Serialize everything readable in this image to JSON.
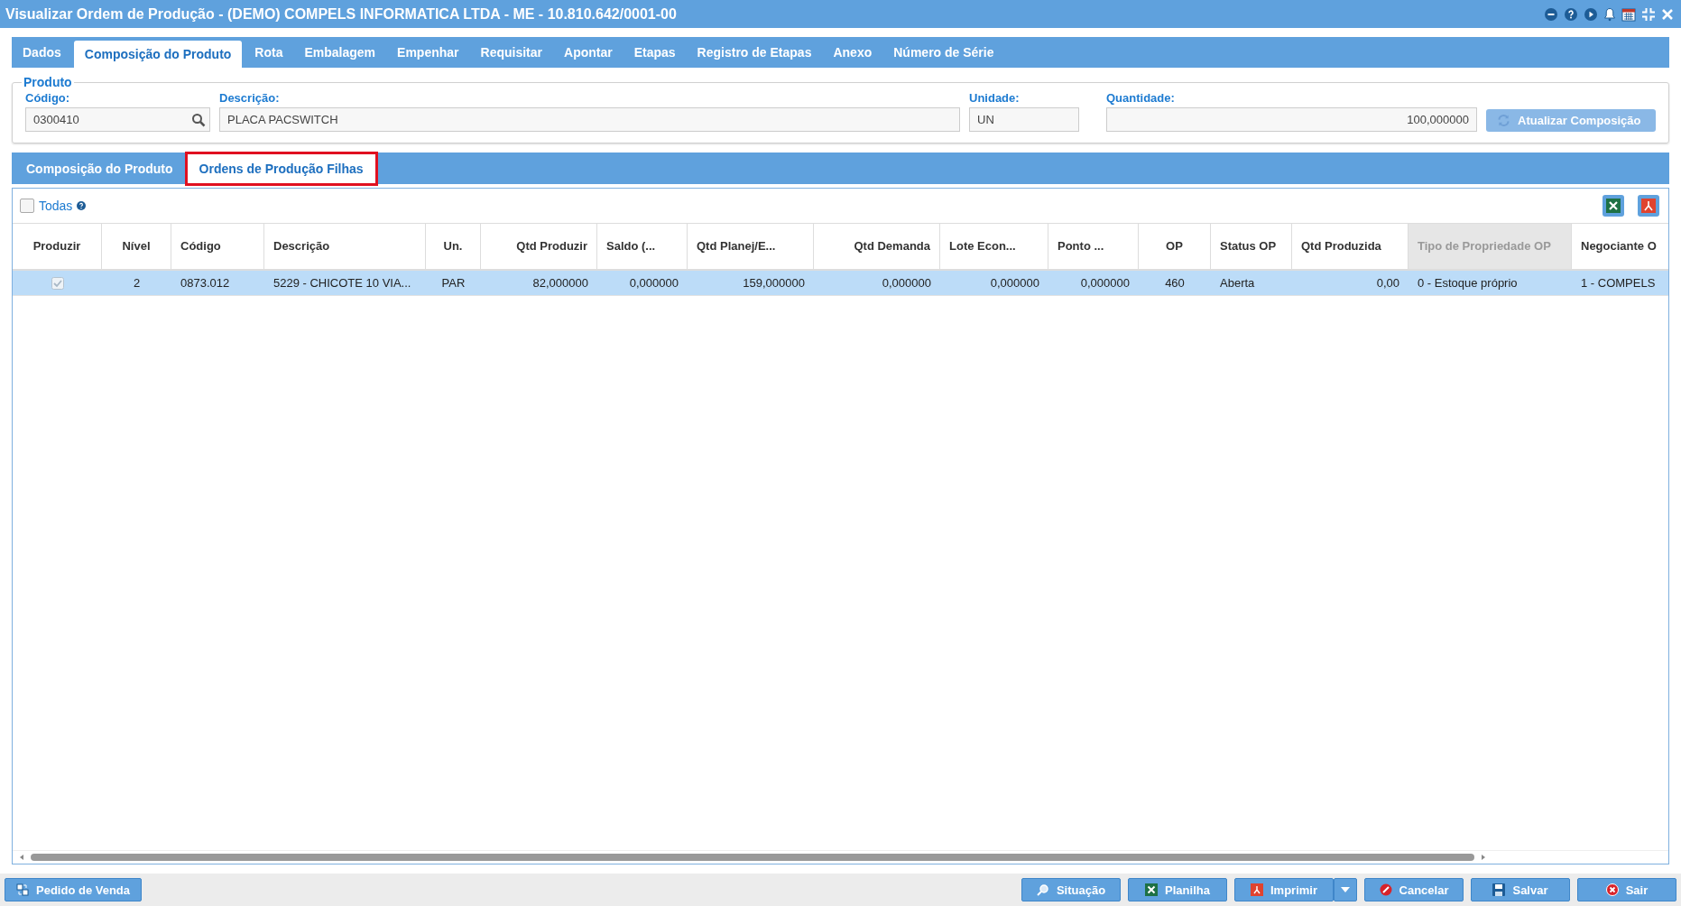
{
  "window": {
    "title": "Visualizar Ordem de Produção - (DEMO) COMPELS INFORMATICA LTDA - ME - 10.810.642/0001-00"
  },
  "tabs": [
    {
      "label": "Dados",
      "selected": false
    },
    {
      "label": "Composição do Produto",
      "selected": true
    },
    {
      "label": "Rota",
      "selected": false
    },
    {
      "label": "Embalagem",
      "selected": false
    },
    {
      "label": "Empenhar",
      "selected": false
    },
    {
      "label": "Requisitar",
      "selected": false
    },
    {
      "label": "Apontar",
      "selected": false
    },
    {
      "label": "Etapas",
      "selected": false
    },
    {
      "label": "Registro de Etapas",
      "selected": false
    },
    {
      "label": "Anexo",
      "selected": false
    },
    {
      "label": "Número de Série",
      "selected": false
    }
  ],
  "produto": {
    "legend": "Produto",
    "codigo": {
      "label": "Código:",
      "value": "0300410"
    },
    "descricao": {
      "label": "Descrição:",
      "value": "PLACA PACSWITCH"
    },
    "unidade": {
      "label": "Unidade:",
      "value": "UN"
    },
    "quantidade": {
      "label": "Quantidade:",
      "value": "100,000000"
    },
    "update_button": {
      "label": "Atualizar Composição",
      "disabled": true
    }
  },
  "subtabs": [
    {
      "label": "Composição do Produto",
      "selected": false
    },
    {
      "label": "Ordens de Produção Filhas",
      "selected": true
    }
  ],
  "grid": {
    "select_all": {
      "label": "Todas",
      "checked": false
    },
    "columns": [
      {
        "label": "Produzir",
        "disabled": false
      },
      {
        "label": "Nível",
        "disabled": false
      },
      {
        "label": "Código",
        "disabled": false
      },
      {
        "label": "Descrição",
        "disabled": false
      },
      {
        "label": "Un.",
        "disabled": false
      },
      {
        "label": "Qtd Produzir",
        "disabled": false
      },
      {
        "label": "Saldo (...",
        "disabled": false
      },
      {
        "label": "Qtd Planej/E...",
        "disabled": false
      },
      {
        "label": "Qtd Demanda",
        "disabled": false
      },
      {
        "label": "Lote Econ...",
        "disabled": false
      },
      {
        "label": "Ponto ...",
        "disabled": false
      },
      {
        "label": "OP",
        "disabled": false
      },
      {
        "label": "Status OP",
        "disabled": false
      },
      {
        "label": "Qtd Produzida",
        "disabled": false
      },
      {
        "label": "Tipo de Propriedade OP",
        "disabled": true
      },
      {
        "label": "Negociante O",
        "disabled": false
      }
    ],
    "rows": [
      {
        "selected": true,
        "produzir": true,
        "cells": [
          "",
          "2",
          "0873.012",
          "5229 - CHICOTE 10 VIA...",
          "PAR",
          "82,000000",
          "0,000000",
          "159,000000",
          "0,000000",
          "0,000000",
          "0,000000",
          "460",
          "Aberta",
          "0,00",
          "0 - Estoque próprio",
          "1 - COMPELS"
        ]
      }
    ]
  },
  "footer": {
    "left_button": "Pedido de Venda",
    "buttons": [
      {
        "label": "Situação",
        "kind": "search"
      },
      {
        "label": "Planilha",
        "kind": "excel"
      },
      {
        "label": "Imprimir",
        "kind": "pdf"
      },
      {
        "label": "Cancelar",
        "kind": "cancel"
      },
      {
        "label": "Salvar",
        "kind": "save"
      },
      {
        "label": "Sair",
        "kind": "exit"
      }
    ]
  }
}
